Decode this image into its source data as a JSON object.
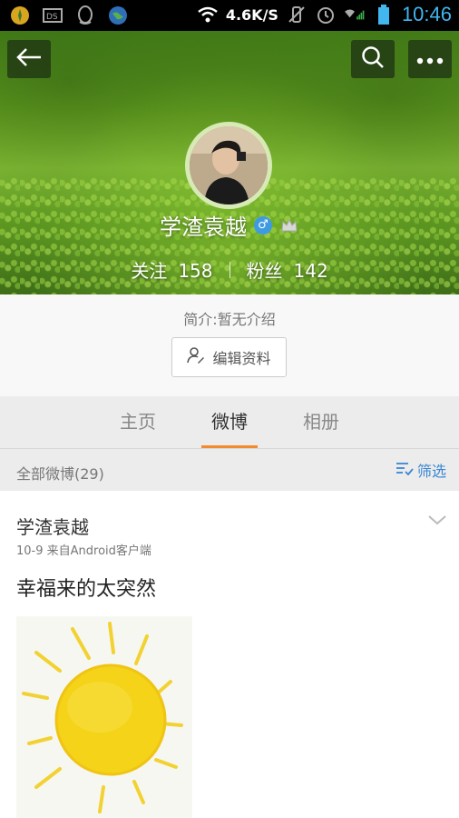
{
  "status_bar": {
    "speed": "4.6K/S",
    "time": "10:46",
    "icons": [
      "app-icon",
      "sim-icon",
      "qq-icon",
      "globe-icon",
      "wifi-icon",
      "no-sound-icon",
      "alarm-icon",
      "signal-icon",
      "battery-icon"
    ]
  },
  "header": {
    "back_icon": "back-arrow-icon",
    "search_icon": "search-icon",
    "more_icon": "more-icon"
  },
  "profile": {
    "name": "学渣袁越",
    "gender_symbol": "♂",
    "following_label": "关注",
    "following_count": "158",
    "followers_label": "粉丝",
    "followers_count": "142",
    "bio": "简介:暂无介绍",
    "edit_label": "编辑资料"
  },
  "tabs": {
    "items": [
      "主页",
      "微博",
      "相册"
    ],
    "active": "微博"
  },
  "feed": {
    "count_label": "全部微博(29)",
    "filter_label": "筛选"
  },
  "post": {
    "author": "学渣袁越",
    "meta": "10-9  来自Android客户端",
    "text": "幸福来的太突然"
  },
  "colors": {
    "accent": "#f48a2c",
    "link": "#3a86d4",
    "clock": "#41b6ef",
    "gender_badge": "#3f9be0"
  }
}
